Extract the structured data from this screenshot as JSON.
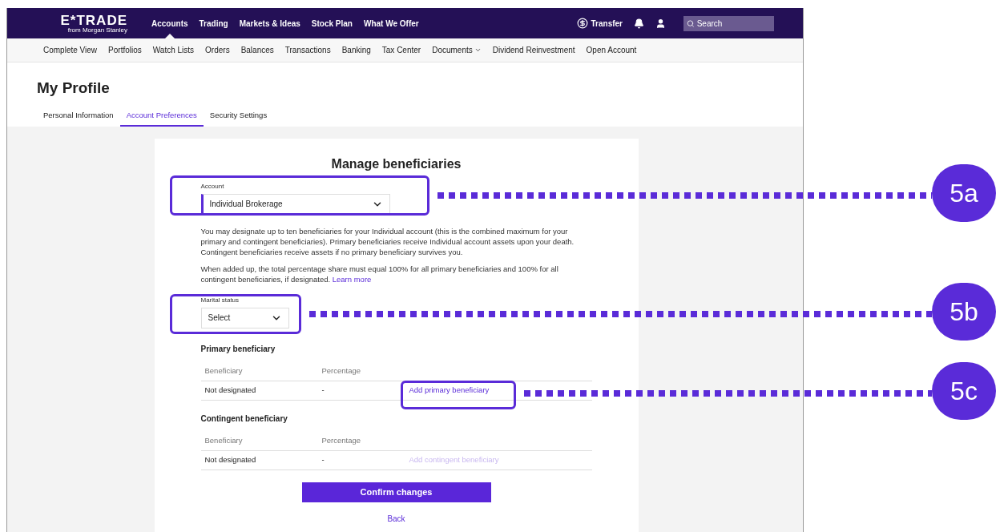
{
  "logo": {
    "name": "E*TRADE",
    "tagline": "from Morgan Stanley"
  },
  "top_nav": [
    {
      "label": "Accounts",
      "selected": true
    },
    {
      "label": "Trading",
      "selected": false
    },
    {
      "label": "Markets & Ideas",
      "selected": false
    },
    {
      "label": "Stock Plan",
      "selected": false
    },
    {
      "label": "What We Offer",
      "selected": false
    }
  ],
  "transfer": "Transfer",
  "search": {
    "placeholder": "Search"
  },
  "sub_nav": [
    {
      "label": "Complete View",
      "has_menu": false
    },
    {
      "label": "Portfolios",
      "has_menu": false
    },
    {
      "label": "Watch Lists",
      "has_menu": false
    },
    {
      "label": "Orders",
      "has_menu": false
    },
    {
      "label": "Balances",
      "has_menu": false
    },
    {
      "label": "Transactions",
      "has_menu": false
    },
    {
      "label": "Banking",
      "has_menu": false
    },
    {
      "label": "Tax Center",
      "has_menu": false
    },
    {
      "label": "Documents",
      "has_menu": true
    },
    {
      "label": "Dividend Reinvestment",
      "has_menu": false
    },
    {
      "label": "Open Account",
      "has_menu": false
    }
  ],
  "page_title": "My Profile",
  "tabs": [
    {
      "label": "Personal Information",
      "selected": false
    },
    {
      "label": "Account Preferences",
      "selected": true
    },
    {
      "label": "Security Settings",
      "selected": false
    }
  ],
  "card": {
    "title": "Manage beneficiaries",
    "account_field": {
      "label": "Account",
      "value": "Individual Brokerage"
    },
    "paragraphs": [
      "You may designate up to ten beneficiaries for your Individual account (this is the combined maximum for your primary and contingent beneficiaries). Primary beneficiaries receive Individual account assets upon your death.",
      "Contingent beneficiaries receive assets if no primary beneficiary survives you."
    ],
    "note": "When added up, the total percentage share must equal 100% for all primary beneficiaries and 100% for all contingent beneficiaries, if designated.",
    "learn_more": "Learn more",
    "marital_field": {
      "label": "Marital status",
      "value": "Select"
    },
    "tables": [
      {
        "title": "Primary beneficiary",
        "columns": [
          "Beneficiary",
          "Percentage"
        ],
        "rows": [
          {
            "beneficiary": "Not designated",
            "percentage": "-",
            "action": "Add primary beneficiary",
            "disabled": false
          }
        ]
      },
      {
        "title": "Contingent beneficiary",
        "columns": [
          "Beneficiary",
          "Percentage"
        ],
        "rows": [
          {
            "beneficiary": "Not designated",
            "percentage": "-",
            "action": "Add contingent beneficiary",
            "disabled": true
          }
        ]
      }
    ],
    "confirm": "Confirm changes",
    "back": "Back"
  },
  "callouts": [
    {
      "label": "5a"
    },
    {
      "label": "5b"
    },
    {
      "label": "5c"
    }
  ]
}
